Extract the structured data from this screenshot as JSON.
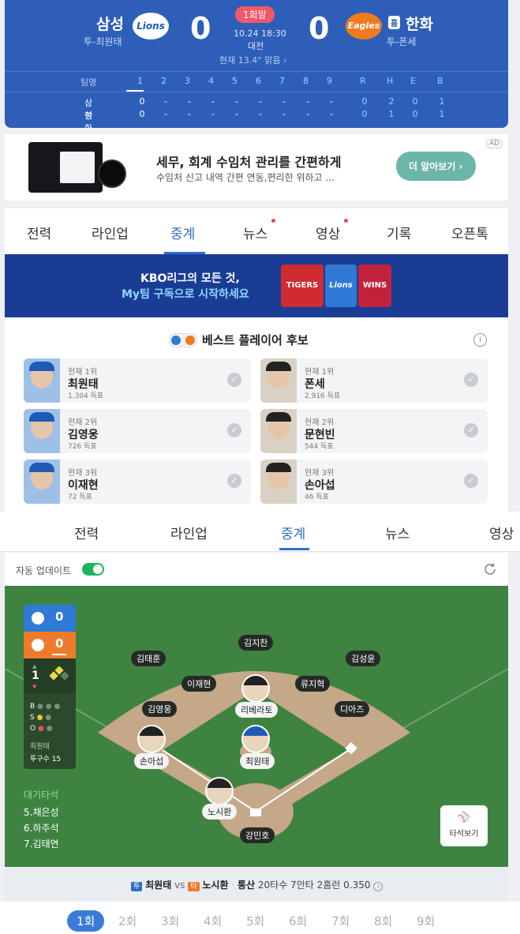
{
  "score": {
    "away": {
      "name": "삼성",
      "pitcher": "투-최원태",
      "score": "0",
      "logo_text": "Lions"
    },
    "home": {
      "name": "한화",
      "pitcher": "투-폰세",
      "score": "0",
      "logo_text": "Eagles",
      "home_badge": "홈"
    },
    "inning": "1회말",
    "datetime": "10.24 18:30",
    "venue": "대전",
    "weather": "현재 13.4° 맑음 ›",
    "table": {
      "header": [
        "팀명",
        "1",
        "2",
        "3",
        "4",
        "5",
        "6",
        "7",
        "8",
        "9",
        "R",
        "H",
        "E",
        "B"
      ],
      "rows": [
        {
          "team": "삼성",
          "cells": [
            "0",
            "-",
            "-",
            "-",
            "-",
            "-",
            "-",
            "-",
            "-",
            "0",
            "2",
            "0",
            "1"
          ]
        },
        {
          "team": "한화",
          "cells": [
            "0",
            "-",
            "-",
            "-",
            "-",
            "-",
            "-",
            "-",
            "-",
            "0",
            "1",
            "0",
            "1"
          ]
        }
      ]
    }
  },
  "ad": {
    "badge": "AD",
    "title": "세무, 회계 수임처 관리를 간편하게",
    "desc": "수임처 신고 내역 간편 연동,편리한 위하고 ...",
    "button": "더 알아보기 ›"
  },
  "tabs": [
    "전력",
    "라인업",
    "중계",
    "뉴스",
    "영상",
    "기록",
    "오픈톡"
  ],
  "banner": {
    "line1": "KBO리그의 모든 것,",
    "line2": "My팀 구독으로 시작하세요",
    "logos": [
      "TIGERS",
      "Lions",
      "WINS"
    ]
  },
  "best": {
    "title": "베스트 플레이어 후보",
    "info_icon": "i",
    "players": [
      {
        "rank": "현재 1위",
        "name": "최원태",
        "votes": "1,304 득표"
      },
      {
        "rank": "현재 1위",
        "name": "폰세",
        "votes": "2,916 득표"
      },
      {
        "rank": "현재 2위",
        "name": "김영웅",
        "votes": "726 득표"
      },
      {
        "rank": "현재 2위",
        "name": "문현빈",
        "votes": "544 득표"
      },
      {
        "rank": "현재 3위",
        "name": "이재현",
        "votes": "72 득표"
      },
      {
        "rank": "현재 3위",
        "name": "손아섭",
        "votes": "46 득표"
      }
    ]
  },
  "tabs2": [
    "전력",
    "라인업",
    "중계",
    "뉴스",
    "영상"
  ],
  "auto_update": "자동 업데이트",
  "field": {
    "away_score": "0",
    "home_score": "0",
    "inning": "1",
    "bso": [
      "B",
      "S",
      "O"
    ],
    "pitcher_label": "최원태",
    "pitch_count": "투구수 15",
    "waiting_title": "대기타석",
    "waiting": [
      "5.채은성",
      "6.하주석",
      "7.김태연"
    ],
    "fielders": {
      "cf": "김지찬",
      "lf": "김태훈",
      "rf": "김성윤",
      "ss": "이재현",
      "b2": "류지혁",
      "b3": "김영웅",
      "b1": "디아즈",
      "catcher": "강민호",
      "pitcher": "최원태"
    },
    "runners": {
      "second": "리베라토",
      "third": "손아섭",
      "batter": "노시환"
    },
    "view_button": "타석보기"
  },
  "matchup": {
    "pitcher_badge": "투",
    "pitcher": "최원태",
    "vs": "vs",
    "batter_badge": "타",
    "batter": "노시환",
    "stats_label": "통산",
    "stats": "20타수 7안타 2홈런 0.350"
  },
  "innings": [
    "1회",
    "2회",
    "3회",
    "4회",
    "5회",
    "6회",
    "7회",
    "8회",
    "9회"
  ],
  "colors": {
    "accent": "#2f6fc9",
    "scoreboard": "#2e5fb8",
    "field": "#3f8340"
  }
}
